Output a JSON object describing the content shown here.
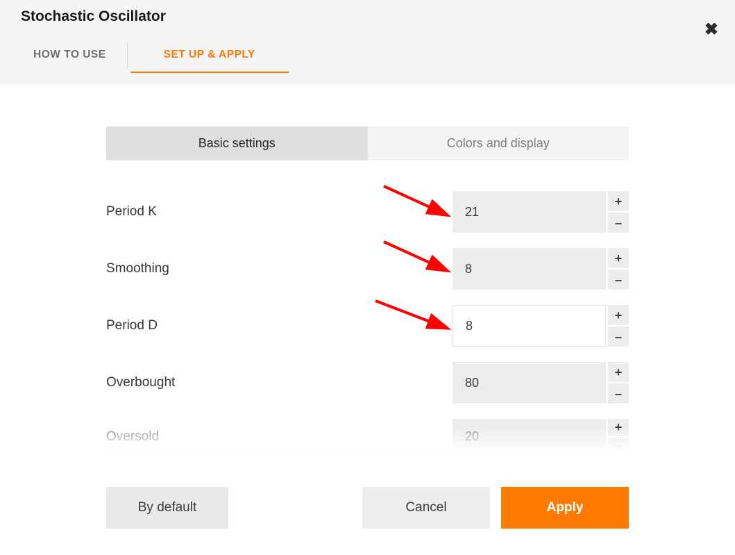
{
  "title": "Stochastic Oscillator",
  "header_tabs": {
    "how_to_use": "HOW TO USE",
    "setup_apply": "SET UP & APPLY"
  },
  "subtabs": {
    "basic": "Basic settings",
    "colors": "Colors and display"
  },
  "fields": {
    "period_k": {
      "label": "Period K",
      "value": "21"
    },
    "smoothing": {
      "label": "Smoothing",
      "value": "8"
    },
    "period_d": {
      "label": "Period D",
      "value": "8"
    },
    "overbought": {
      "label": "Overbought",
      "value": "80"
    },
    "oversold": {
      "label": "Oversold",
      "value": "20"
    }
  },
  "buttons": {
    "by_default": "By default",
    "cancel": "Cancel",
    "apply": "Apply"
  },
  "glyphs": {
    "plus": "+",
    "minus": "–"
  },
  "colors": {
    "accent": "#ff7a00"
  }
}
